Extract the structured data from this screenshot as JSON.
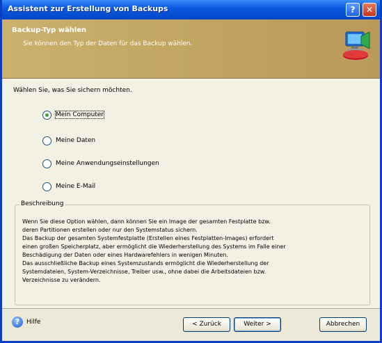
{
  "window": {
    "title": "Assistent zur Erstellung von Backups",
    "help_btn": "?",
    "close_btn": "✕"
  },
  "header": {
    "title": "Backup-Typ wählen",
    "subtitle": "Sie können den Typ der Daten für das Backup wählen."
  },
  "question": "Wählen Sie, was Sie sichern möchten.",
  "options": [
    {
      "label": "Mein Computer",
      "selected": true
    },
    {
      "label": "Meine Daten",
      "selected": false
    },
    {
      "label": "Meine Anwendungseinstellungen",
      "selected": false
    },
    {
      "label": "Meine E-Mail",
      "selected": false
    }
  ],
  "description": {
    "title": "Beschreibung",
    "text": "Wenn Sie diese Option wählen, dann können Sie ein Image der gesamten Festplatte bzw.\nderen Partitionen erstellen oder nur den Systemstatus sichern.\nDas Backup der gesamten Systemfestplatte (Erstellen eines Festplatten-Images) erfordert\neinen großen Speicherplatz, aber ermöglicht die Wiederherstellung des Systems im Falle einer\nBeschädigung der Daten oder eines Hardwarefehlers in wenigen Minuten.\nDas ausschließliche Backup eines Systemzustands ermöglicht die Wiederherstellung der\nSystemdateien, System-Verzeichnisse, Treiber usw., ohne dabei die Arbeitsdateien bzw.\nVerzeichnisse zu verändern."
  },
  "footer": {
    "help": "Hilfe",
    "back": "< Zurück",
    "next": "Weiter >",
    "cancel": "Abbrechen"
  },
  "icons": {
    "help": "help-icon",
    "logo": "backup-computer-icon"
  }
}
